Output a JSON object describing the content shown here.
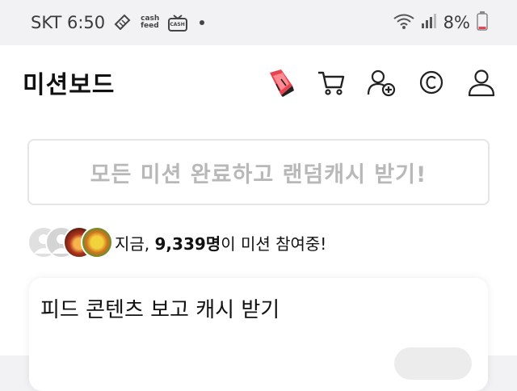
{
  "status_bar": {
    "carrier_time": "SKT 6:50",
    "cashfeed_top": "cash",
    "cashfeed_bottom": "feed",
    "tv_label": "CASH",
    "battery": "8%"
  },
  "header": {
    "title": "미션보드"
  },
  "banner": {
    "text": "모든 미션 완료하고 랜덤캐시 받기!"
  },
  "participants": {
    "prefix": "지금, ",
    "count": "9,339명",
    "suffix": "이 미션 참여중!"
  },
  "mission_card": {
    "title": "피드 콘텐츠 보고 캐시 받기"
  },
  "colors": {
    "accent": "#e8434f",
    "banner_text": "#b8b8b8"
  }
}
